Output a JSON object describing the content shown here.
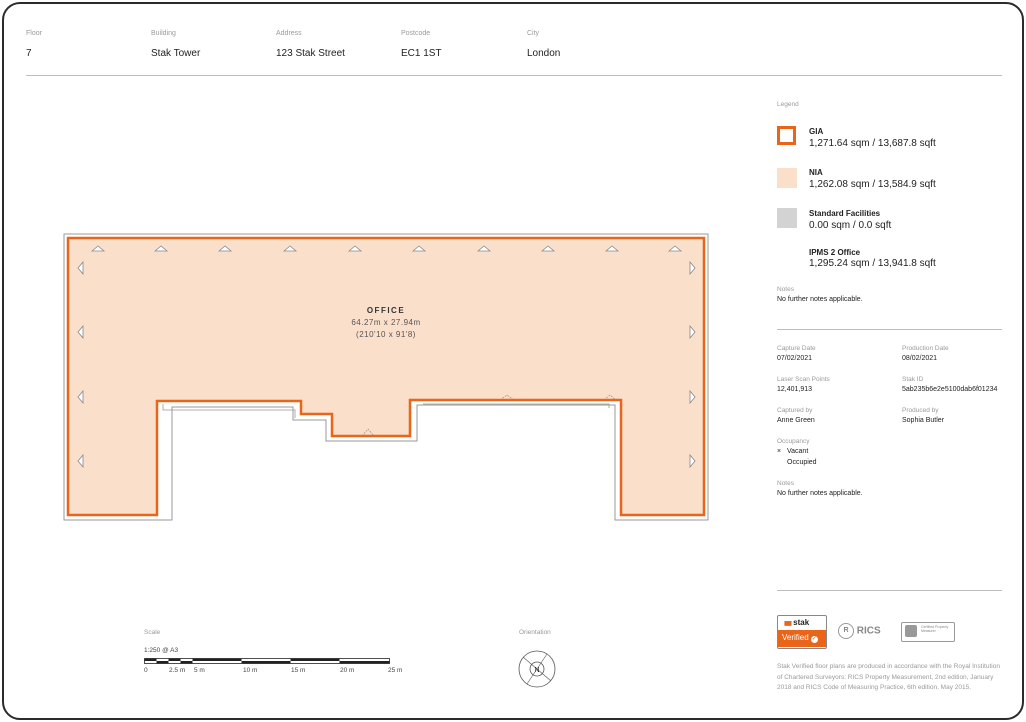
{
  "header": {
    "floor_label": "Floor",
    "floor_value": "7",
    "building_label": "Building",
    "building_value": "Stak Tower",
    "address_label": "Address",
    "address_value": "123 Stak Street",
    "postcode_label": "Postcode",
    "postcode_value": "EC1 1ST",
    "city_label": "City",
    "city_value": "London"
  },
  "legend": {
    "title": "Legend",
    "items": [
      {
        "name": "GIA",
        "value": "1,271.64 sqm / 13,687.8 sqft",
        "color": "#e8651a"
      },
      {
        "name": "NIA",
        "value": "1,262.08 sqm / 13,584.9 sqft",
        "color": "#fadfcb"
      },
      {
        "name": "Standard Facilities",
        "value": "0.00 sqm / 0.0 sqft",
        "color": "#d3d3d3"
      },
      {
        "name": "IPMS 2 Office",
        "value": "1,295.24 sqm / 13,941.8 sqft",
        "color": "#ffffff"
      }
    ],
    "notes_label": "Notes",
    "notes_value": "No further notes applicable."
  },
  "details": {
    "capture_date_label": "Capture Date",
    "capture_date": "07/02/2021",
    "production_date_label": "Production Date",
    "production_date": "08/02/2021",
    "laser_label": "Laser Scan Points",
    "laser_value": "12,401,913",
    "stak_id_label": "Stak ID",
    "stak_id": "5ab235b6e2e5100dab6f01234",
    "captured_by_label": "Captured by",
    "captured_by": "Anne Green",
    "produced_by_label": "Produced by",
    "produced_by": "Sophia Butler",
    "occupancy_label": "Occupancy",
    "occupancy_options": [
      "Vacant",
      "Occupied"
    ],
    "occupancy_selected_mark": "×",
    "notes_label": "Notes",
    "notes_value": "No further notes applicable."
  },
  "plan": {
    "room_name": "OFFICE",
    "room_dims_m": "64.27m x 27.94m",
    "room_dims_ft": "(210'10 x 91'8)",
    "nia_color": "#fadfcb",
    "gia_color": "#e8651a"
  },
  "scale": {
    "label": "Scale",
    "ratio": "1:250 @ A3",
    "ticks": [
      "0",
      "2.5 m",
      "5 m",
      "10 m",
      "15 m",
      "20 m",
      "25 m"
    ]
  },
  "orientation": {
    "label": "Orientation",
    "north": "N"
  },
  "badges": {
    "stak": "stak",
    "verified": "Verified",
    "rics": "RICS",
    "certified": "Certified Property Measurer"
  },
  "footnote": "Stak Verified floor plans are produced in accordance with the Royal Institution of Chartered Surveyors: RICS Property Measurement, 2nd edition, January 2018 and RICS Code of Measuring Practice, 6th edition, May 2015."
}
